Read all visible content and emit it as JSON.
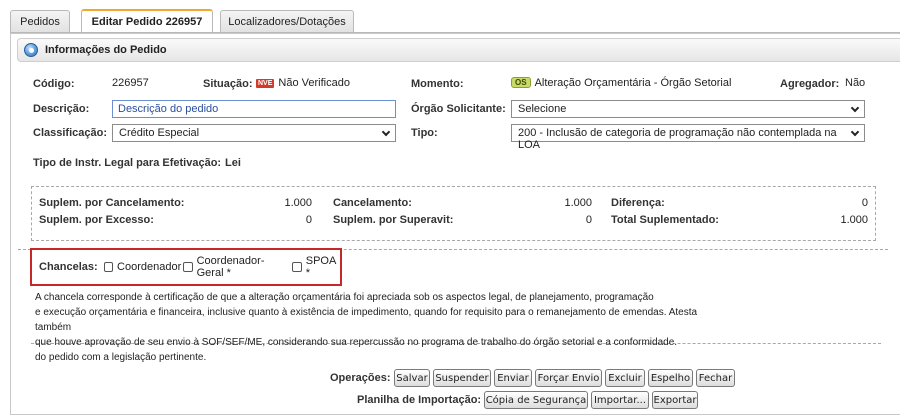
{
  "tabs": [
    {
      "label": "Pedidos"
    },
    {
      "label": "Editar Pedido 226957"
    },
    {
      "label": "Localizadores/Dotações"
    }
  ],
  "panel": {
    "title": "Informações do Pedido"
  },
  "fields": {
    "codigo_label": "Código:",
    "codigo_value": "226957",
    "situacao_label": "Situação:",
    "situacao_badge": "NVE",
    "situacao_value": "Não Verificado",
    "momento_label": "Momento:",
    "momento_badge": "OS",
    "momento_value": "Alteração Orçamentária - Órgão Setorial",
    "agregador_label": "Agregador:",
    "agregador_value": "Não",
    "descricao_label": "Descrição:",
    "descricao_value": "Descrição do pedido",
    "orgao_label": "Órgão Solicitante:",
    "orgao_value": "Selecione",
    "classificacao_label": "Classificação:",
    "classificacao_value": "Crédito Especial",
    "tipo_label": "Tipo:",
    "tipo_value": "200 - Inclusão de categoria de programação não contemplada na LOA",
    "instr_label": "Tipo de Instr. Legal para Efetivação:",
    "instr_value": "Lei"
  },
  "totals": {
    "suplem_cancelamento_label": "Suplem. por Cancelamento:",
    "suplem_cancelamento_value": "1.000",
    "suplem_excesso_label": "Suplem. por Excesso:",
    "suplem_excesso_value": "0",
    "cancelamento_label": "Cancelamento:",
    "cancelamento_value": "1.000",
    "suplem_superavit_label": "Suplem. por Superavit:",
    "suplem_superavit_value": "0",
    "diferenca_label": "Diferença:",
    "diferenca_value": "0",
    "total_suplementado_label": "Total Suplementado:",
    "total_suplementado_value": "1.000"
  },
  "chancelas": {
    "label": "Chancelas:",
    "options": [
      "Coordenador",
      "Coordenador-Geral *",
      "SPOA *"
    ]
  },
  "note": [
    "A chancela corresponde à certificação de que a alteração orçamentária foi apreciada sob os aspectos legal, de planejamento, programação",
    "e execução orçamentária e financeira, inclusive quanto à existência de impedimento, quando for requisito para o remanejamento de emendas. Atesta também",
    "que houve aprovação de seu envio à SOF/SEF/ME, considerando sua repercussão no programa de trabalho do órgão setorial e a conformidade.",
    "do pedido com a legislação pertinente."
  ],
  "operacoes": {
    "label": "Operações:",
    "buttons": [
      "Salvar",
      "Suspender",
      "Enviar",
      "Forçar Envio",
      "Excluir",
      "Espelho",
      "Fechar"
    ]
  },
  "planilha": {
    "label": "Planilha de Importação:",
    "buttons": [
      "Cópia de Segurança",
      "Importar...",
      "Exportar"
    ]
  }
}
